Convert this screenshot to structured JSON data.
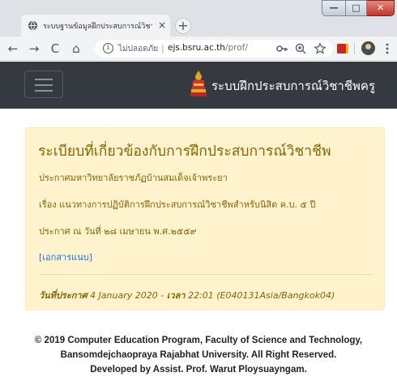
{
  "browser": {
    "tab_title": "ระบบฐานข้อมูลฝึกประสบการณ์วิชาชีพ",
    "tab_close": "×",
    "new_tab": "+",
    "address": {
      "security_status": "ไม่ปลอดภัย",
      "separator": "|",
      "host": "ejs.bsru.ac.th",
      "path": "/prof/"
    },
    "nav": {
      "back": "←",
      "forward": "→",
      "reload": "C",
      "home": "⌂"
    },
    "window_controls": {
      "minimize": "—",
      "maximize": "□",
      "close": "✕"
    }
  },
  "navbar": {
    "brand": "ระบบฝึกประสบการณ์วิชาชีพครู"
  },
  "notice": {
    "title": "ระเบียบที่เกี่ยวข้องกับการฝึกประสบการณ์วิชาชีพ",
    "lines": [
      "ประกาศมหาวิทยาลัยราชภัฏบ้านสมเด็จเจ้าพระยา",
      "เรื่อง แนวทางการปฏิบัติการฝึกประสบการณ์วิชาชีพสำหรับนิสิต ค.บ. ๕ ปี",
      "ประกาศ ณ วันที่ ๒๘ เมษายน พ.ศ.๒๕๕๙"
    ],
    "attachment_link": "[เอกสารแนบ]",
    "announced_label": "วันที่ประกาศ",
    "announced_date": "4 January 2020",
    "time_label": "เวลา",
    "time_value": "22:01 (E040131Asia/Bangkok04)"
  },
  "footer": {
    "line1": "© 2019 Computer Education Program, Faculty of Science and Technology,",
    "line2": "Bansomdejchaopraya Rajabhat University. All Right Reserved.",
    "line3": "Developed by Assist. Prof. Warut Ploysuayngam."
  },
  "colors": {
    "navbar_bg": "#343a40",
    "card_bg": "#fff3cd",
    "card_text": "#856404",
    "link": "#1a73e8"
  }
}
